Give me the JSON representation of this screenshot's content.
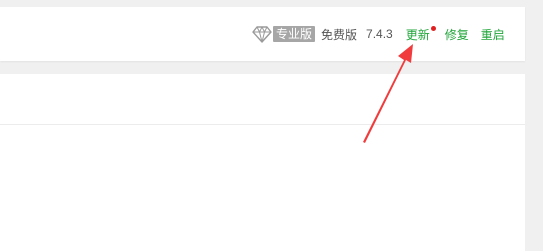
{
  "header": {
    "pro_badge": "专业版",
    "free_label": "免费版",
    "version": "7.4.3",
    "update_label": "更新",
    "repair_label": "修复",
    "restart_label": "重启"
  },
  "icons": {
    "diamond": "diamond-icon",
    "update_dot": "notification-dot",
    "annotation": "red-arrow"
  },
  "colors": {
    "action_green": "#20a53a",
    "badge_gray": "#a6a6a6",
    "annotation_red": "#f03c3c",
    "dot_red": "#e02020"
  }
}
